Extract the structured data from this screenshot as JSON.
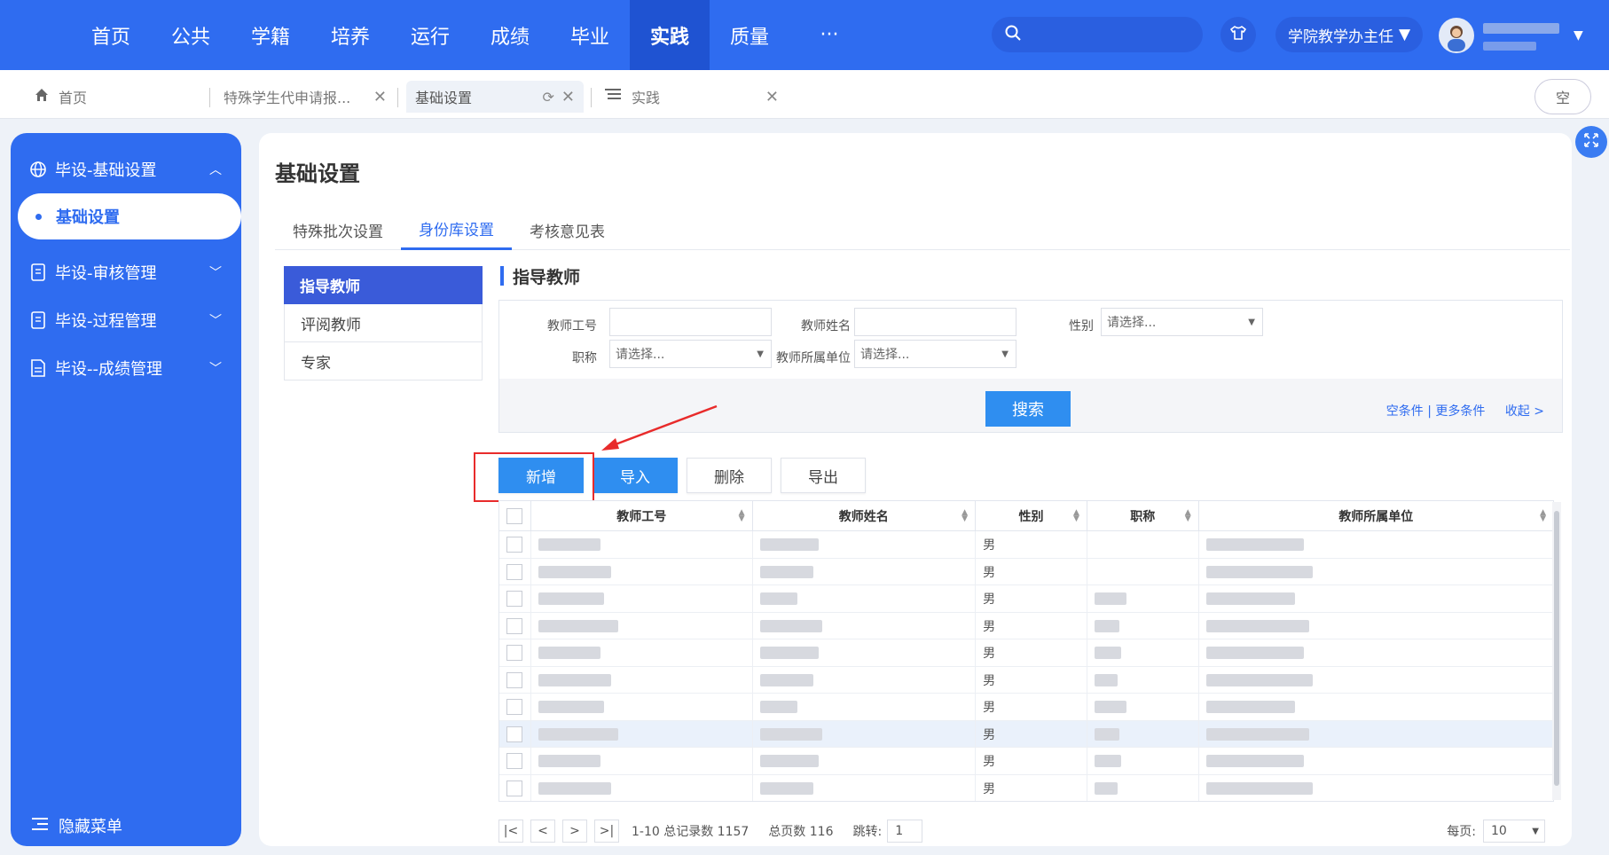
{
  "topnav": {
    "items": [
      {
        "label": "首页"
      },
      {
        "label": "公共"
      },
      {
        "label": "学籍"
      },
      {
        "label": "培养"
      },
      {
        "label": "运行"
      },
      {
        "label": "成绩"
      },
      {
        "label": "毕业"
      },
      {
        "label": "实践",
        "active": true
      },
      {
        "label": "质量"
      },
      {
        "label": "···"
      }
    ],
    "search_placeholder": "",
    "role": "学院教学办主任",
    "brand_color": "#2f6cf0"
  },
  "tabs": [
    {
      "label": "首页",
      "icon": "home-icon"
    },
    {
      "label": "特殊学生代申请报...",
      "icon": ""
    },
    {
      "label": "基础设置",
      "icon": "",
      "active": true
    },
    {
      "label": "实践",
      "icon": "list-icon"
    }
  ],
  "clear_label": "空",
  "sidebar": {
    "groups": [
      {
        "label": "毕设-基础设置",
        "icon": "globe-icon",
        "expanded": true
      },
      {
        "label": "毕设-审核管理",
        "icon": "document-icon"
      },
      {
        "label": "毕设-过程管理",
        "icon": "document-icon"
      },
      {
        "label": "毕设--成绩管理",
        "icon": "document-edit-icon"
      }
    ],
    "active_item": "基础设置",
    "hide_menu": "隐藏菜单"
  },
  "page": {
    "title": "基础设置",
    "sub_tabs": [
      {
        "label": "特殊批次设置"
      },
      {
        "label": "身份库设置",
        "active": true
      },
      {
        "label": "考核意见表"
      }
    ],
    "left_list": [
      {
        "label": "指导教师",
        "active": true
      },
      {
        "label": "评阅教师"
      },
      {
        "label": "专家"
      }
    ],
    "section_title": "指导教师"
  },
  "filter": {
    "teacher_id_label": "教师工号",
    "teacher_name_label": "教师姓名",
    "gender_label": "性别",
    "gender_value": "请选择...",
    "title_label": "职称",
    "title_value": "请选择...",
    "dept_label": "教师所属单位",
    "dept_value": "请选择...",
    "search": "搜索",
    "clear_conditions": "空条件",
    "more_conditions": "更多条件",
    "collapse": "收起 >"
  },
  "actions": {
    "add": "新增",
    "import": "导入",
    "delete": "删除",
    "export": "导出"
  },
  "table": {
    "columns": [
      "教师工号",
      "教师姓名",
      "性别",
      "职称",
      "教师所属单位"
    ],
    "rows": [
      {
        "gender": "男"
      },
      {
        "gender": "男"
      },
      {
        "gender": "男"
      },
      {
        "gender": "男"
      },
      {
        "gender": "男"
      },
      {
        "gender": "男"
      },
      {
        "gender": "男"
      },
      {
        "gender": "男"
      },
      {
        "gender": "男"
      },
      {
        "gender": "男"
      }
    ]
  },
  "pager": {
    "records": "1-10 总记录数 1157",
    "pages": "总页数 116",
    "jump_label": "跳转:",
    "jump_value": "1",
    "per_page_label": "每页:",
    "per_page_value": "10"
  }
}
